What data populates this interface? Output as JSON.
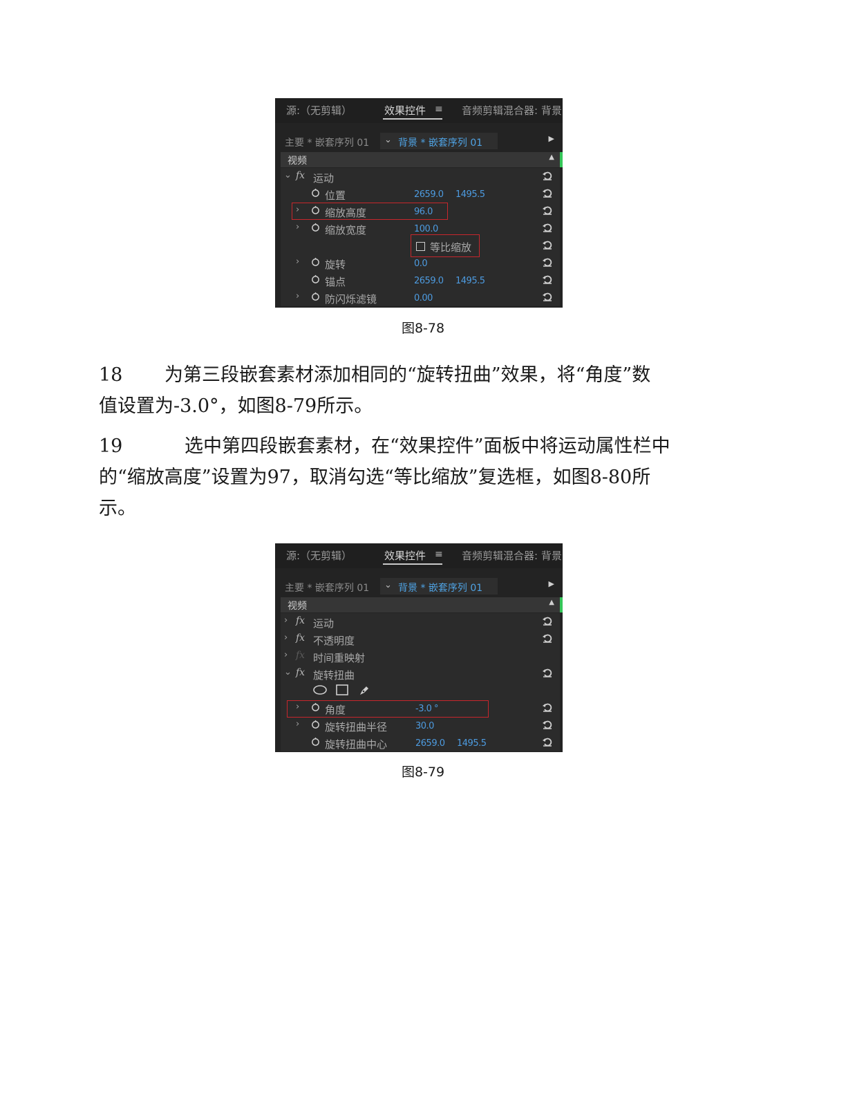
{
  "figure_78": {
    "tabs": {
      "source": "源:（无剪辑）",
      "effects": "效果控件",
      "menu": "≡",
      "mixer": "音频剪辑混合器: 背景"
    },
    "seq_left": "主要 * 嵌套序列 01",
    "seq_right": "背景 * 嵌套序列 01",
    "video_label": "视频",
    "rows": [
      {
        "label": "运动"
      },
      {
        "label": "位置",
        "v1": "2659.0",
        "v2": "1495.5"
      },
      {
        "label": "缩放高度",
        "v1": "96.0"
      },
      {
        "label": "缩放宽度",
        "v1": "100.0"
      },
      {
        "checkbox_label": "等比缩放",
        "checked": false
      },
      {
        "label": "旋转",
        "v1": "0.0"
      },
      {
        "label": "锚点",
        "v1": "2659.0",
        "v2": "1495.5"
      },
      {
        "label": "防闪烁滤镜",
        "v1": "0.00"
      }
    ],
    "caption": "图8-78"
  },
  "steps": [
    {
      "num": "18",
      "lines": [
        "为第三段嵌套素材添加相同的“旋转扭曲”效果，将“角度”数",
        "值设置为-3.0°，如图8-79所示。"
      ]
    },
    {
      "num": "19",
      "lines": [
        "选中第四段嵌套素材，在“效果控件”面板中将运动属性栏中",
        "的“缩放高度”设置为97，取消勾选“等比缩放”复选框，如图8-80所",
        "示。"
      ]
    }
  ],
  "figure_79": {
    "tabs": {
      "source": "源:（无剪辑）",
      "effects": "效果控件",
      "menu": "≡",
      "mixer": "音频剪辑混合器: 背景"
    },
    "seq_left": "主要 * 嵌套序列 01",
    "seq_right": "背景 * 嵌套序列 01",
    "video_label": "视频",
    "rows": [
      {
        "label": "运动"
      },
      {
        "label": "不透明度"
      },
      {
        "label": "时间重映射"
      },
      {
        "label": "旋转扭曲"
      },
      {
        "label": ""
      },
      {
        "label": "角度",
        "v1": "-3.0 °"
      },
      {
        "label": "旋转扭曲半径",
        "v1": "30.0"
      },
      {
        "label": "旋转扭曲中心",
        "v1": "2659.0",
        "v2": "1495.5"
      }
    ],
    "caption": "图8-79"
  },
  "colors": {
    "panel_bg": "#232323",
    "row_bg": "#2b2b2b",
    "value_blue": "#4d9be0",
    "highlight_red": "#c8262c",
    "accent_green": "#35c759"
  }
}
